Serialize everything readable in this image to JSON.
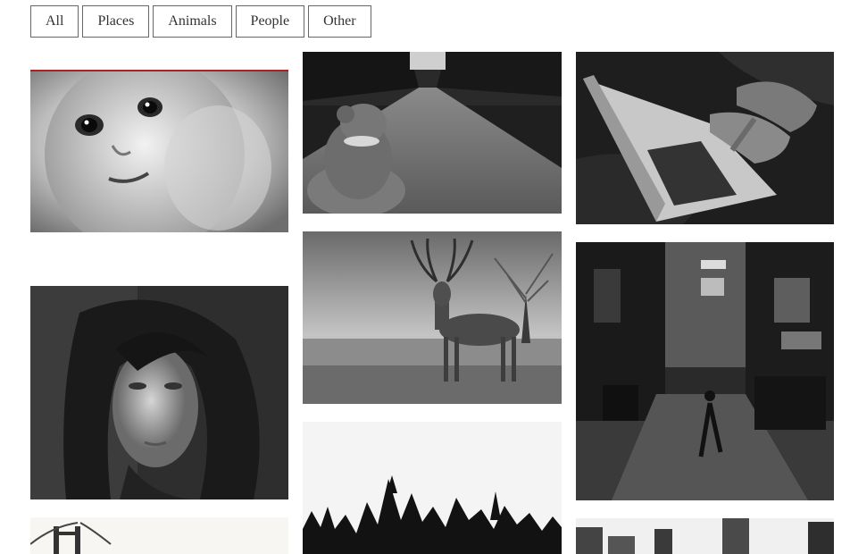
{
  "filters": [
    {
      "label": "All"
    },
    {
      "label": "Places"
    },
    {
      "label": "Animals"
    },
    {
      "label": "People"
    },
    {
      "label": "Other"
    }
  ],
  "gallery": {
    "images": [
      {
        "name": "baby-face-image"
      },
      {
        "name": "teddy-bear-road-image"
      },
      {
        "name": "laptop-hands-image"
      },
      {
        "name": "woman-portrait-image"
      },
      {
        "name": "deer-field-image"
      },
      {
        "name": "city-street-night-image"
      },
      {
        "name": "concert-crowd-image"
      },
      {
        "name": "bridge-image"
      },
      {
        "name": "city-buildings-image"
      }
    ]
  }
}
